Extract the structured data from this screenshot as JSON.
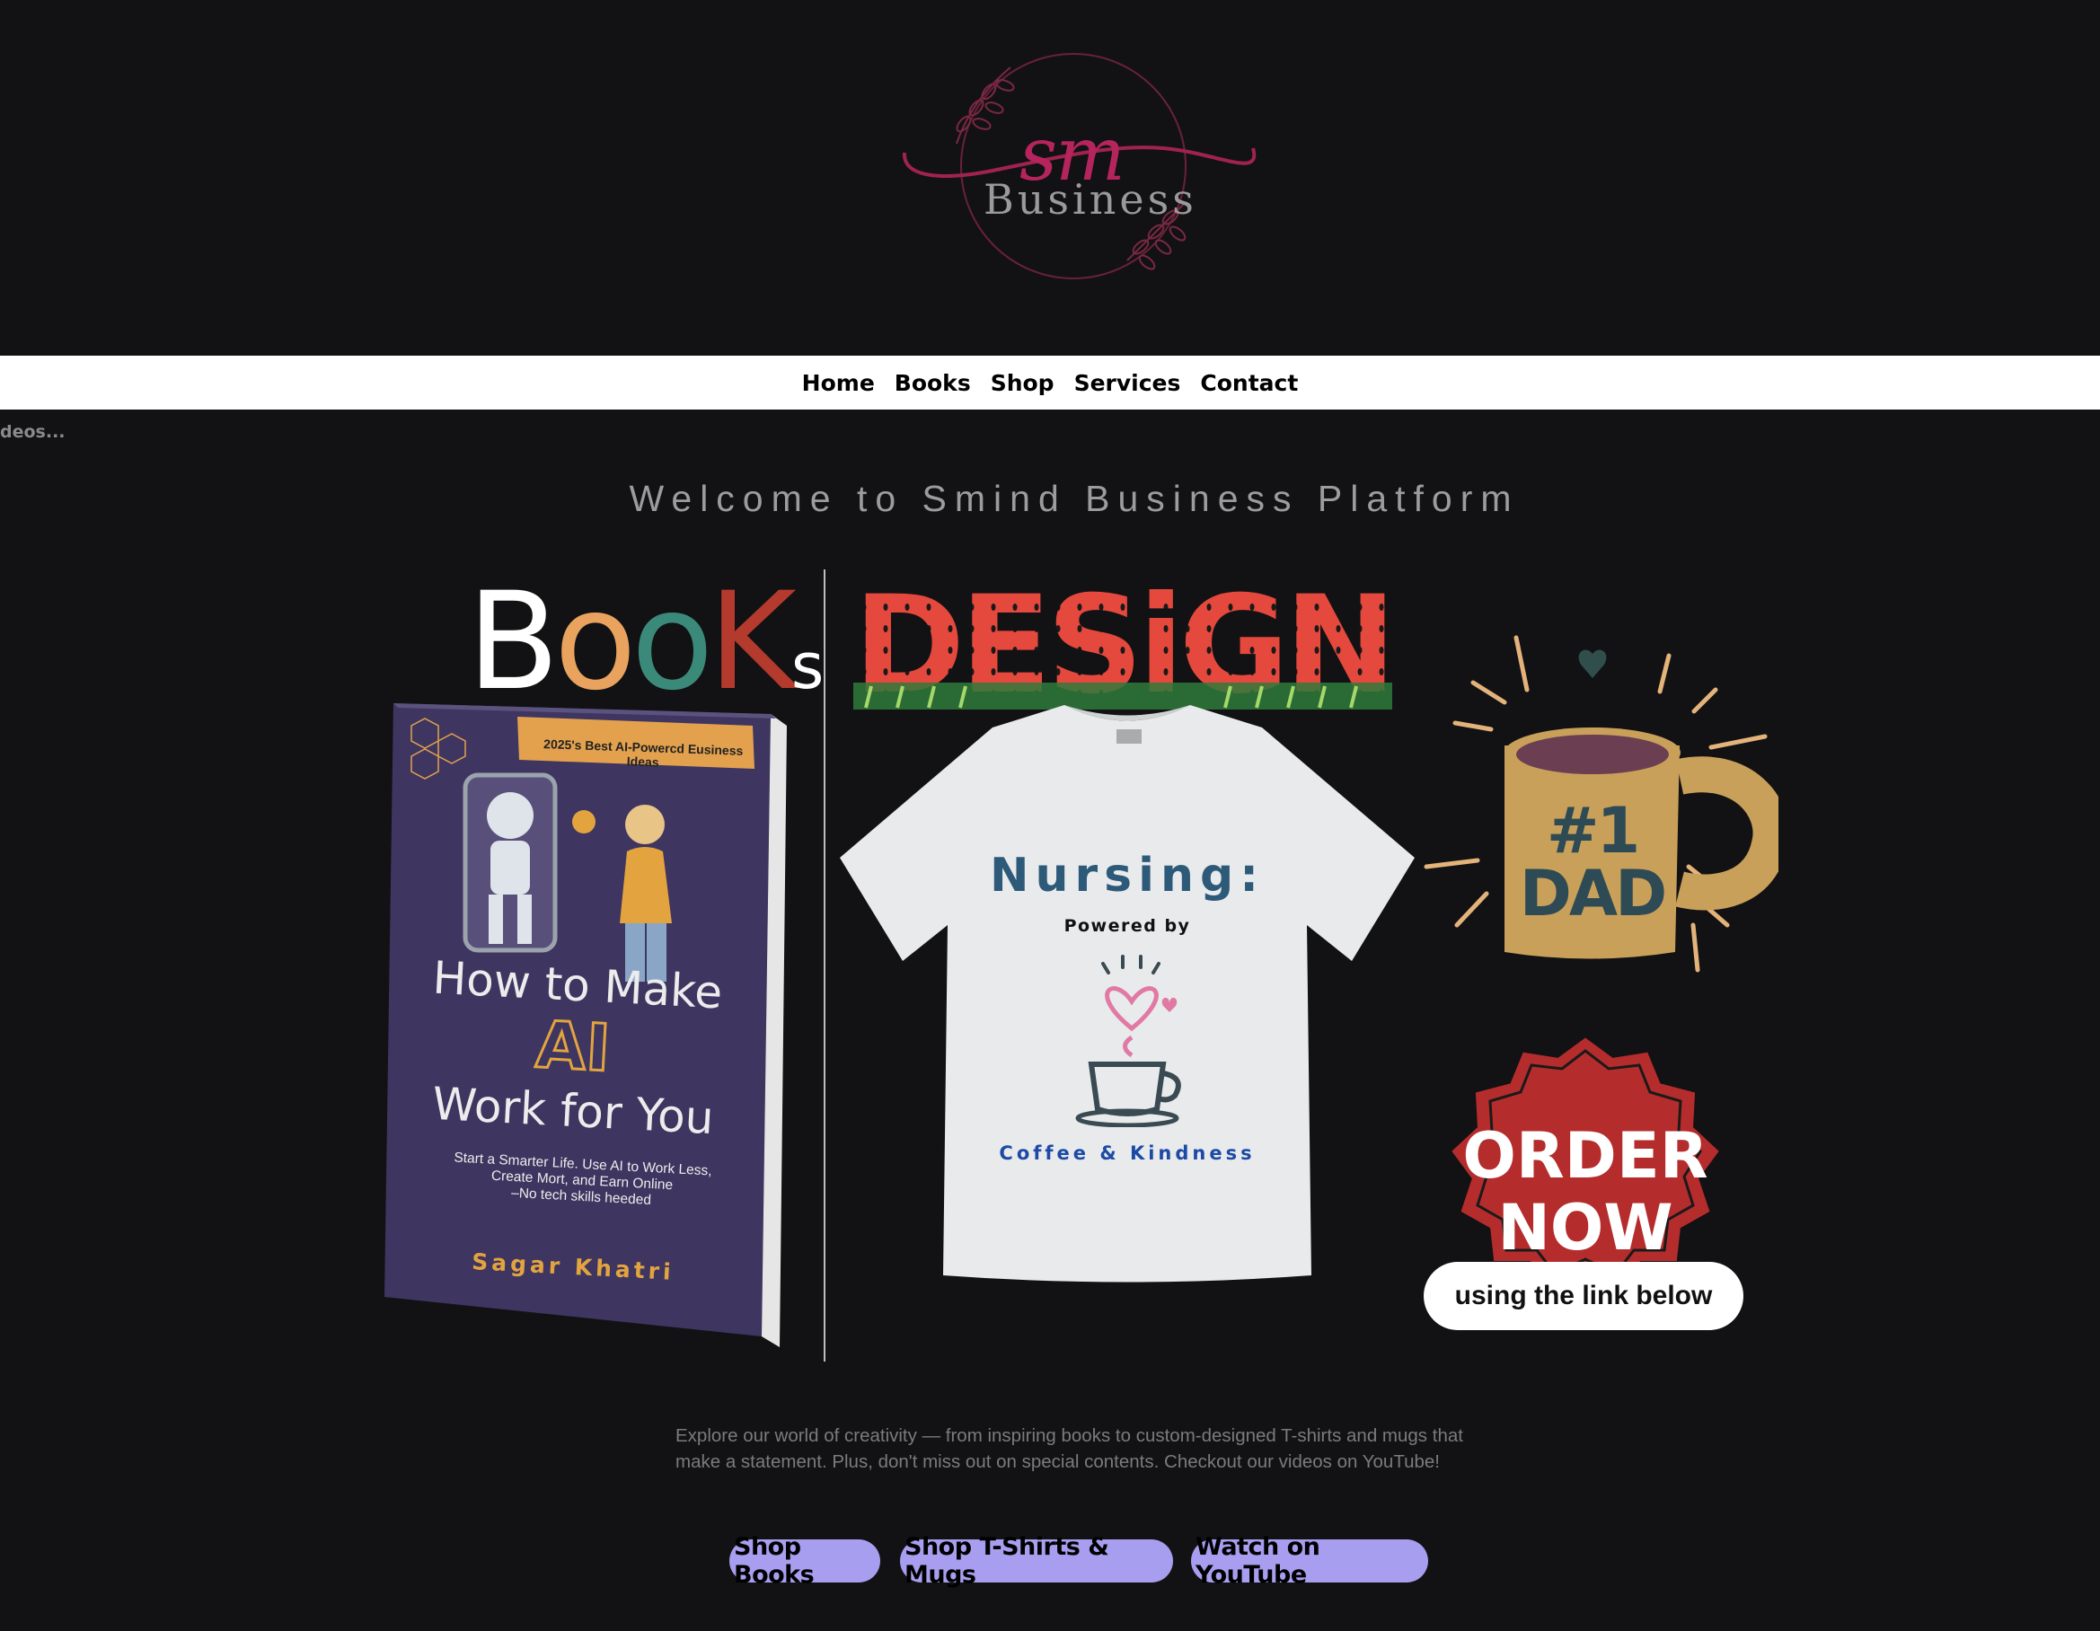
{
  "header": {
    "logo": {
      "mark": "sm",
      "word": "Business",
      "color": "#b6245e"
    }
  },
  "nav": {
    "items": [
      "Home",
      "Books",
      "Shop",
      "Services",
      "Contact"
    ]
  },
  "ticker": {
    "text": "deos..."
  },
  "hero": {
    "welcome": "Welcome to Smind Business Platform"
  },
  "books_banner": {
    "letters": [
      "B",
      "o",
      "o",
      "K",
      "s"
    ]
  },
  "book": {
    "tagline": "2025's Best AI-Powercd Eusiness Ideas",
    "title_line1": "How to Make",
    "title_ai": "AI",
    "title_line2": "Work for You",
    "subtitle_line1": "Start a Smarter Life. Use AI to Work Less,",
    "subtitle_line2": "Create Mort, and Earn Online",
    "subtitle_line3": "–No tech skills heeded",
    "author": "Sagar Khatri"
  },
  "design_banner": {
    "text": "DESiGN"
  },
  "tshirt": {
    "headline": "Nursing:",
    "powered": "Powered by",
    "tagline": "Coffee & Kindness"
  },
  "mug": {
    "line1": "#1",
    "line2": "DAD"
  },
  "order": {
    "line1": "ORDER",
    "line2": "NOW",
    "pill": "using the link below"
  },
  "intro": {
    "text": "Explore our world of creativity — from inspiring books to custom-designed T-shirts and mugs that make a statement. Plus, don't miss out on special contents. Checkout our videos on YouTube!"
  },
  "cta": {
    "books": "Shop Books",
    "shirts": "Shop T-Shirts & Mugs",
    "youtube": "Watch on YouTube",
    "color": "#a89ef0"
  }
}
